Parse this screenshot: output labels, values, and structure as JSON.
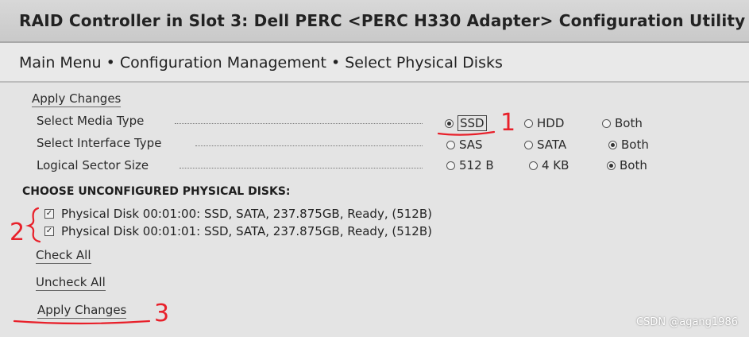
{
  "window": {
    "title": "RAID Controller in Slot 3: Dell PERC <PERC H330 Adapter> Configuration Utility"
  },
  "breadcrumb": "Main Menu • Configuration Management • Select Physical Disks",
  "links": {
    "apply_top": "Apply Changes",
    "check_all": "Check All",
    "uncheck_all": "Uncheck All",
    "apply_bottom": "Apply Changes"
  },
  "settings": [
    {
      "label": "Select Media Type",
      "options": [
        "SSD",
        "HDD",
        "Both"
      ],
      "selected": "SSD"
    },
    {
      "label": "Select Interface Type",
      "options": [
        "SAS",
        "SATA",
        "Both"
      ],
      "selected": "Both"
    },
    {
      "label": "Logical Sector Size",
      "options": [
        "512 B",
        "4 KB",
        "Both"
      ],
      "selected": "Both"
    }
  ],
  "disks_heading": "CHOOSE UNCONFIGURED PHYSICAL DISKS:",
  "disks": [
    {
      "label": "Physical Disk 00:01:00: SSD, SATA, 237.875GB, Ready, (512B)",
      "checked": true
    },
    {
      "label": "Physical Disk 00:01:01: SSD, SATA, 237.875GB, Ready, (512B)",
      "checked": true
    }
  ],
  "annotations": {
    "marker_1": "1",
    "marker_2": "2",
    "marker_3": "3",
    "color": "#e8202a"
  },
  "watermark": "CSDN @agang1986"
}
